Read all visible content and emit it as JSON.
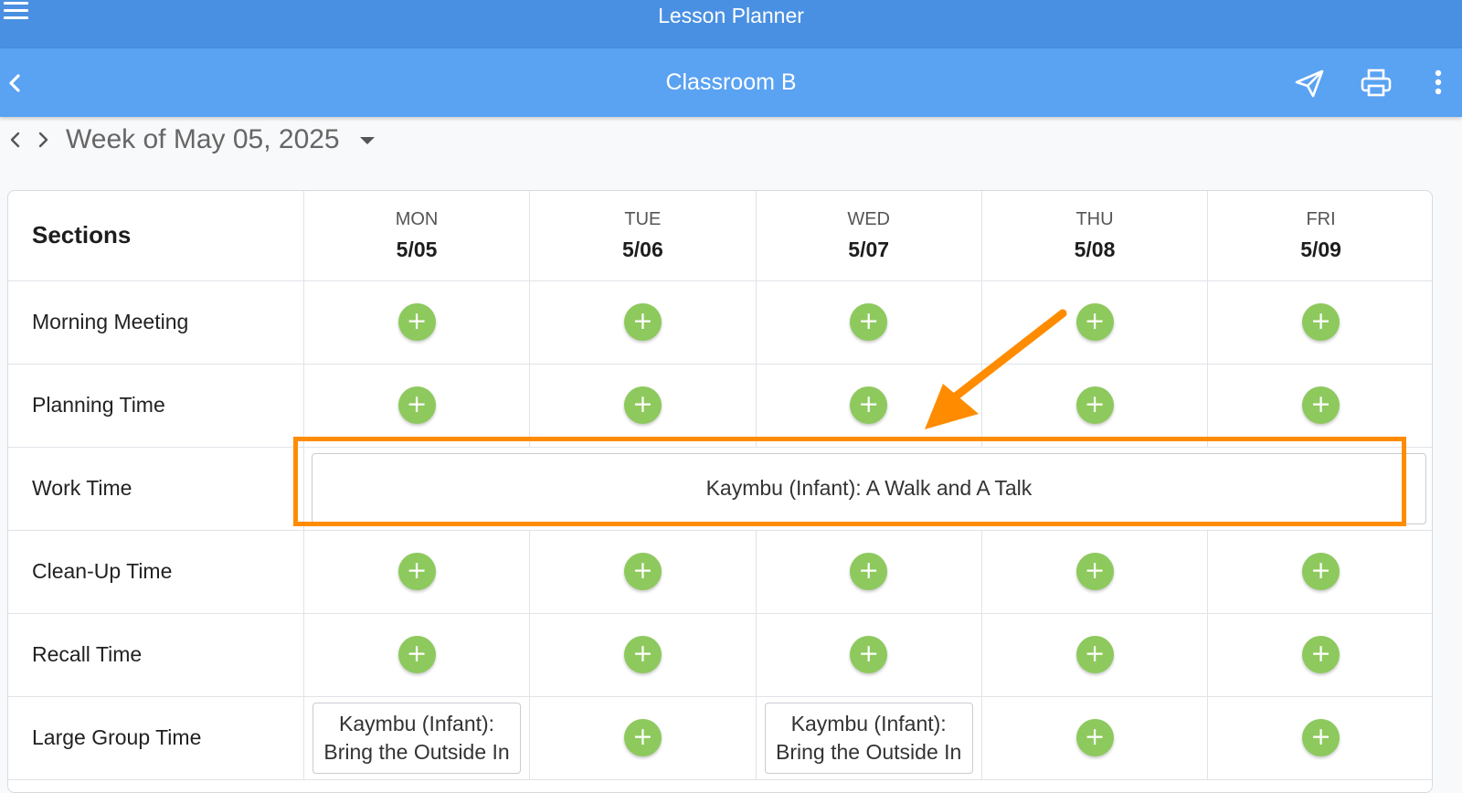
{
  "app_bar": {
    "title": "Lesson Planner",
    "menu_icon": "hamburger-menu-icon"
  },
  "sub_bar": {
    "title": "Classroom B",
    "back_icon": "chevron-left-icon",
    "actions": [
      "send-icon",
      "print-icon",
      "more-vertical-icon"
    ]
  },
  "week": {
    "label": "Week of May 05, 2025",
    "prev_icon": "chevron-left-icon",
    "next_icon": "chevron-right-icon",
    "caret_icon": "caret-down-icon"
  },
  "table": {
    "sections_header": "Sections",
    "days": [
      {
        "name": "MON",
        "date": "5/05"
      },
      {
        "name": "TUE",
        "date": "5/06"
      },
      {
        "name": "WED",
        "date": "5/07"
      },
      {
        "name": "THU",
        "date": "5/08"
      },
      {
        "name": "FRI",
        "date": "5/09"
      }
    ],
    "rows": [
      {
        "section": "Morning Meeting"
      },
      {
        "section": "Planning Time"
      },
      {
        "section": "Work Time",
        "week_activity": "Kaymbu (Infant): A Walk and A Talk"
      },
      {
        "section": "Clean-Up Time"
      },
      {
        "section": "Recall Time"
      },
      {
        "section": "Large Group Time",
        "activities": {
          "mon": "Kaymbu (Infant): Bring the Outside In",
          "wed": "Kaymbu (Infant): Bring the Outside In"
        }
      }
    ],
    "add_symbol": "+"
  },
  "colors": {
    "app_bar": "#4a90e2",
    "sub_bar": "#5aa2f2",
    "add_button": "#8dc95d",
    "highlight": "#ff8c00"
  }
}
